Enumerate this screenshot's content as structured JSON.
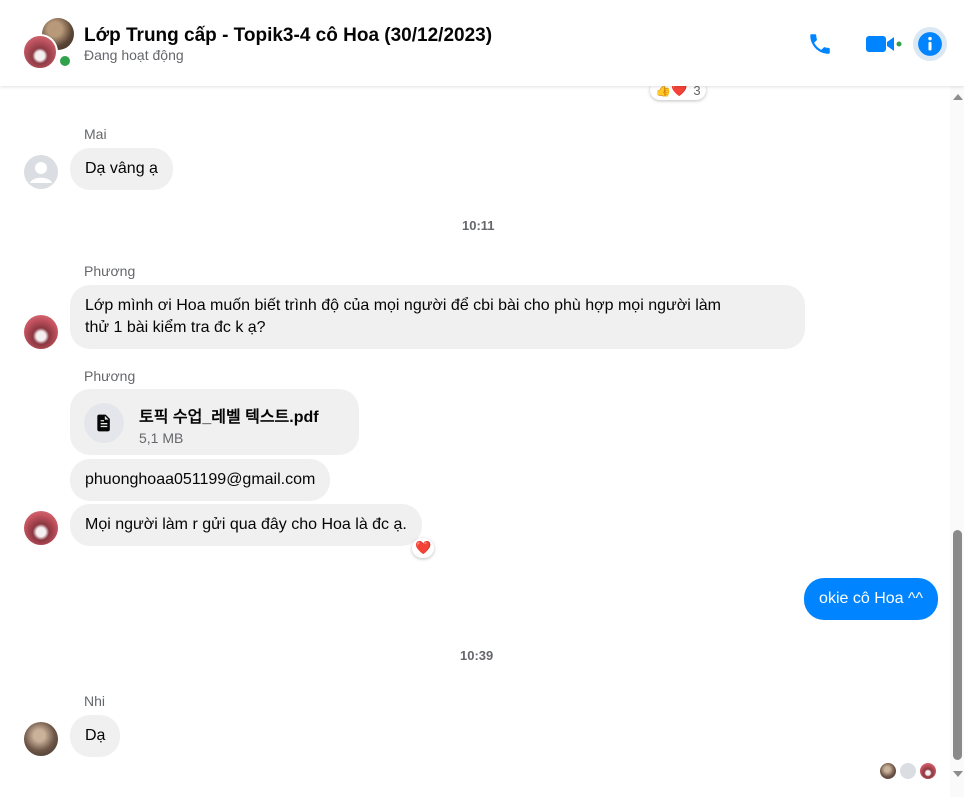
{
  "header": {
    "title": "Lớp Trung cấp - Topik3-4 cô Hoa (30/12/2023)",
    "status": "Đang hoạt động",
    "actions": [
      "phone-icon",
      "video-icon",
      "info-icon"
    ],
    "accent_color": "#0084ff",
    "online_color": "#31a24c"
  },
  "reactions_top": {
    "emojis": "👍❤️",
    "count": "3"
  },
  "messages": {
    "mai": {
      "sender": "Mai",
      "text": "Dạ vâng ạ"
    },
    "time1": "10:11",
    "phuong1": {
      "sender": "Phương",
      "line1": "Lớp mình ơi Hoa muốn biết trình độ của mọi người để cbi bài cho phù hợp mọi người làm",
      "line2": "thử 1 bài kiểm tra đc k ạ?"
    },
    "phuong2": {
      "sender": "Phương",
      "file_name": "토픽 수업_레벨 텍스트.pdf",
      "file_size": "5,1 MB",
      "email": "phuonghoaa051199@gmail.com",
      "text": "Mọi người làm r gửi qua đây cho Hoa là đc ạ.",
      "reaction": "❤️"
    },
    "me": {
      "text": "okie cô Hoa ^^"
    },
    "time2": "10:39",
    "nhi": {
      "sender": "Nhi",
      "text": "Dạ"
    }
  }
}
